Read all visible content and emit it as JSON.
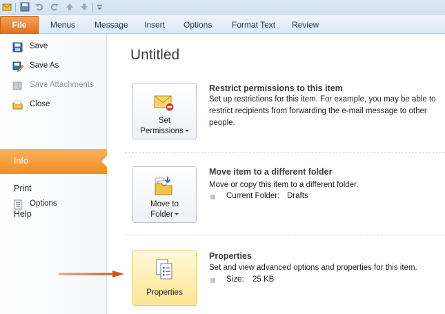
{
  "ribbon": {
    "file_tab": "File",
    "tabs": [
      "Menus",
      "Message",
      "Insert",
      "Options",
      "Format Text",
      "Review"
    ]
  },
  "backstage_menu": {
    "save": "Save",
    "save_as": "Save As",
    "save_attachments": "Save Attachments",
    "close": "Close",
    "info": "Info",
    "print": "Print",
    "help": "Help",
    "options": "Options"
  },
  "main": {
    "title": "Untitled",
    "permissions": {
      "button_line1": "Set",
      "button_line2": "Permissions",
      "heading": "Restrict permissions to this item",
      "text": "Set up restrictions for this item. For example, you may be able to restrict recipients from forwarding the e-mail message to other people."
    },
    "move": {
      "button_line1": "Move to",
      "button_line2": "Folder",
      "heading": "Move item to a different folder",
      "text": "Move or copy this item to a different folder.",
      "folder_label": "Current Folder:",
      "folder_value": "Drafts"
    },
    "properties": {
      "button": "Properties",
      "heading": "Properties",
      "text": "Set and view advanced options and properties for this item.",
      "size_label": "Size:",
      "size_value": "25 KB"
    }
  },
  "colors": {
    "file_tab": "#e2721c",
    "info_highlight": "#f08d22",
    "arrow": "#d9531e",
    "properties_button": "#fde592"
  }
}
